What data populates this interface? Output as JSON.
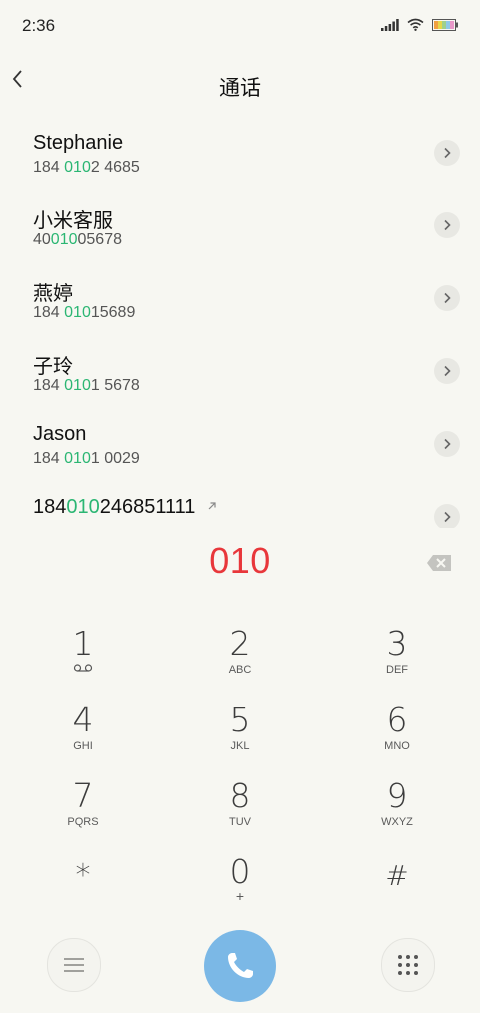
{
  "status": {
    "time": "2:36"
  },
  "nav": {
    "title": "通话"
  },
  "results": [
    {
      "name": "Stephanie",
      "num_pre": "184 ",
      "num_hl": "010",
      "num_post": "2 4685"
    },
    {
      "name": "小米客服",
      "num_pre": "40",
      "num_hl": "010",
      "num_post": "05678"
    },
    {
      "name": "燕婷",
      "num_pre": "184 ",
      "num_hl": "010",
      "num_post": "15689"
    },
    {
      "name": "子玲",
      "num_pre": "184 ",
      "num_hl": "010",
      "num_post": "1 5678"
    },
    {
      "name": "Jason",
      "num_pre": "184 ",
      "num_hl": "010",
      "num_post": "1 0029"
    },
    {
      "name_pre": "184",
      "name_hl": "010",
      "name_post": "246851111"
    }
  ],
  "dial": {
    "value": "010"
  },
  "keypad": [
    {
      "digit": "1",
      "letters": ""
    },
    {
      "digit": "2",
      "letters": "ABC"
    },
    {
      "digit": "3",
      "letters": "DEF"
    },
    {
      "digit": "4",
      "letters": "GHI"
    },
    {
      "digit": "5",
      "letters": "JKL"
    },
    {
      "digit": "6",
      "letters": "MNO"
    },
    {
      "digit": "7",
      "letters": "PQRS"
    },
    {
      "digit": "8",
      "letters": "TUV"
    },
    {
      "digit": "9",
      "letters": "WXYZ"
    },
    {
      "digit": "*",
      "letters": ""
    },
    {
      "digit": "0",
      "letters": "+"
    },
    {
      "digit": "#",
      "letters": ""
    }
  ],
  "colors": {
    "highlight": "#2bb673",
    "dial_text": "#e8373b",
    "call_button": "#7bb8e6"
  },
  "icons": {
    "back": "chevron-left-icon",
    "row_action": "chevron-right-icon",
    "delete": "backspace-icon",
    "menu": "menu-icon",
    "call": "phone-icon",
    "keypad": "dialpad-icon"
  }
}
